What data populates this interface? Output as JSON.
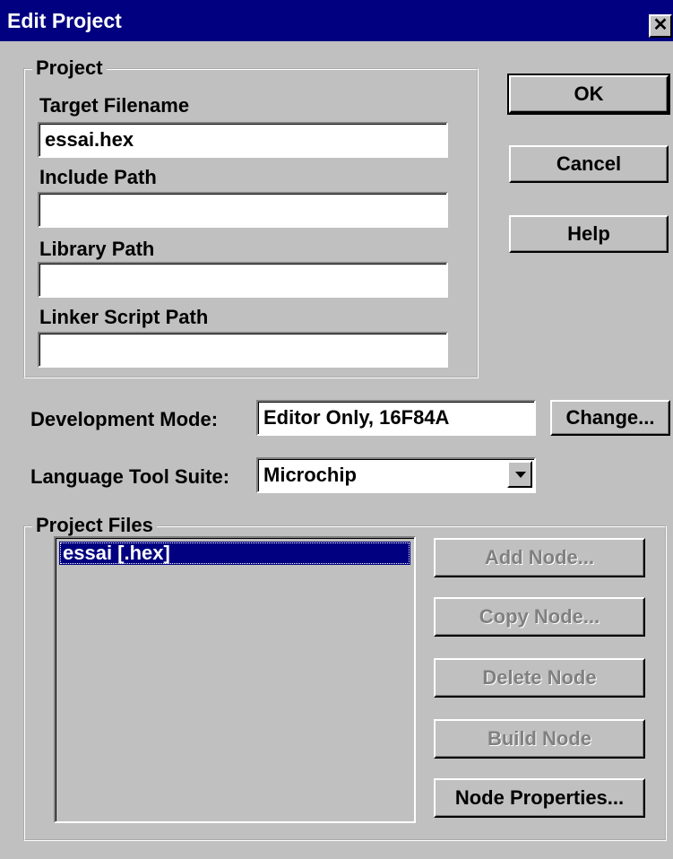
{
  "window": {
    "title": "Edit Project",
    "close_glyph": "✕"
  },
  "project_group": {
    "legend": "Project",
    "target_filename": {
      "label": "Target Filename",
      "value": "essai.hex"
    },
    "include_path": {
      "label": "Include Path",
      "value": ""
    },
    "library_path": {
      "label": "Library Path",
      "value": ""
    },
    "linker_script_path": {
      "label": "Linker Script Path",
      "value": ""
    }
  },
  "dialog_buttons": {
    "ok": "OK",
    "cancel": "Cancel",
    "help": "Help"
  },
  "development_mode": {
    "label": "Development Mode:",
    "value": "Editor Only, 16F84A",
    "change_button": "Change..."
  },
  "language_tool_suite": {
    "label": "Language Tool Suite:",
    "value": "Microchip"
  },
  "project_files": {
    "legend": "Project Files",
    "items": [
      "essai [.hex]"
    ],
    "buttons": {
      "add_node": "Add Node...",
      "copy_node": "Copy Node...",
      "delete_node": "Delete Node",
      "build_node": "Build Node",
      "node_properties": "Node Properties..."
    }
  },
  "colors": {
    "titlebar": "#000080",
    "face": "#c0c0c0",
    "disabled_text": "#808080",
    "selection": "#000080"
  }
}
